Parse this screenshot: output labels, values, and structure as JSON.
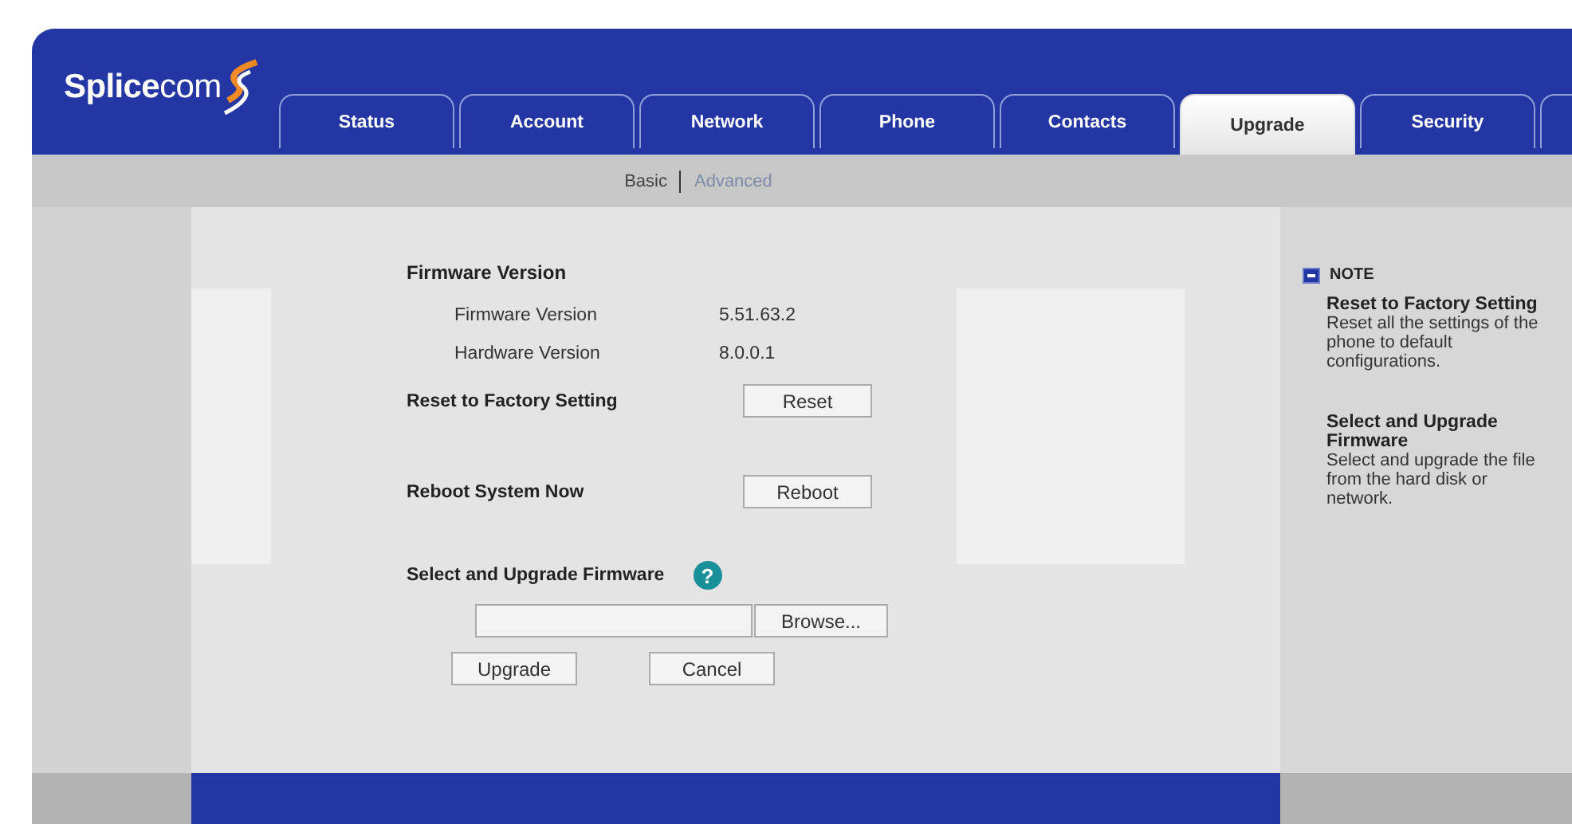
{
  "logo": {
    "text": "**Splice**com"
  },
  "tabs": [
    {
      "label": "Status",
      "selected": false
    },
    {
      "label": "Account",
      "selected": false
    },
    {
      "label": "Network",
      "selected": false
    },
    {
      "label": "Phone",
      "selected": false
    },
    {
      "label": "Contacts",
      "selected": false
    },
    {
      "label": "Upgrade",
      "selected": true
    },
    {
      "label": "Security",
      "selected": false
    }
  ],
  "subnav": [
    {
      "label": "Basic",
      "selected": true
    },
    {
      "label": "Advanced",
      "selected": false
    }
  ],
  "firmware": {
    "heading": "Firmware Version",
    "rows": [
      {
        "label": "Firmware Version",
        "value": "5.51.63.2"
      },
      {
        "label": "Hardware Version",
        "value": "8.0.0.1"
      }
    ]
  },
  "reset": {
    "label": "Reset to Factory Setting",
    "button": "Reset"
  },
  "reboot": {
    "label": "Reboot System Now",
    "button": "Reboot"
  },
  "upgrade": {
    "label": "Select and Upgrade Firmware",
    "help": "?",
    "browse": "Browse...",
    "buttons": [
      "Upgrade",
      "Cancel"
    ]
  },
  "note": {
    "title": "NOTE",
    "items": [
      {
        "title": "Reset to Factory Setting",
        "text": "Reset all the settings of the phone to default configurations."
      },
      {
        "title": "Select and Upgrade Firmware",
        "text": "Select and upgrade the file from the hard disk or network."
      }
    ]
  }
}
